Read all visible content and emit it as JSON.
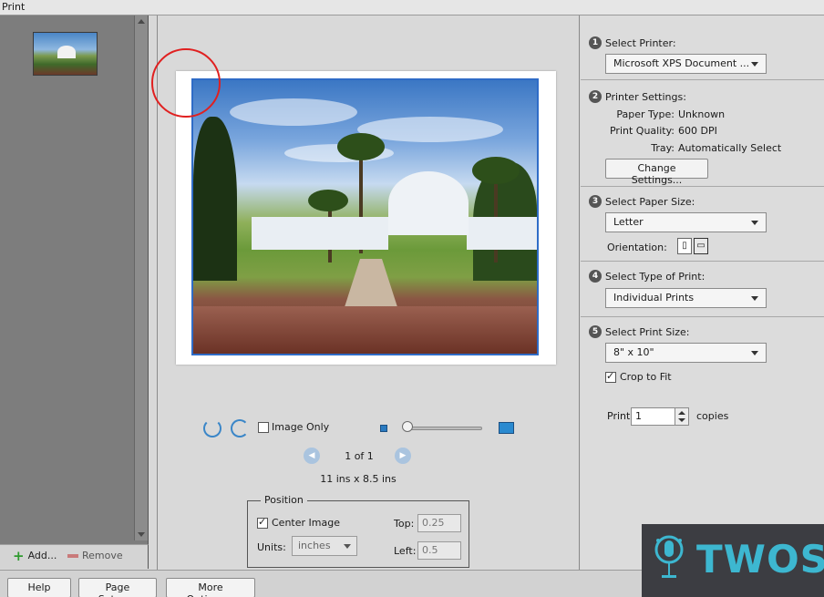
{
  "window": {
    "title": "Print"
  },
  "left_panel": {
    "add_label": "Add...",
    "remove_label": "Remove"
  },
  "preview": {
    "image_only_label": "Image Only",
    "page_indicator": "1 of 1",
    "page_dimensions": "11 ins x 8.5 ins",
    "zoom_level": 0.0
  },
  "position": {
    "legend": "Position",
    "center_image_label": "Center Image",
    "center_image_checked": true,
    "units_label": "Units:",
    "units_value": "inches",
    "top_label": "Top:",
    "top_value": "0.25",
    "left_label": "Left:",
    "left_value": "0.5"
  },
  "right_panel": {
    "select_printer": {
      "step": "1",
      "title": "Select Printer:",
      "value": "Microsoft XPS Document ..."
    },
    "printer_settings": {
      "step": "2",
      "title": "Printer Settings:",
      "paper_type_label": "Paper Type:",
      "paper_type_value": "Unknown",
      "print_quality_label": "Print Quality:",
      "print_quality_value": "600 DPI",
      "tray_label": "Tray:",
      "tray_value": "Automatically Select",
      "change_settings_label": "Change Settings..."
    },
    "paper_size": {
      "step": "3",
      "title": "Select Paper Size:",
      "value": "Letter",
      "orientation_label": "Orientation:"
    },
    "print_type": {
      "step": "4",
      "title": "Select Type of Print:",
      "value": "Individual Prints"
    },
    "print_size": {
      "step": "5",
      "title": "Select Print Size:",
      "value": "8\" x 10\"",
      "crop_label": "Crop to Fit",
      "crop_checked": true
    },
    "copies": {
      "print_label": "Print",
      "value": "1",
      "copies_label": "copies"
    }
  },
  "bottom_bar": {
    "help_label": "Help",
    "page_setup_label": "Page Setup...",
    "more_options_label": "More Options..."
  },
  "watermark": {
    "text": "TWOS"
  }
}
